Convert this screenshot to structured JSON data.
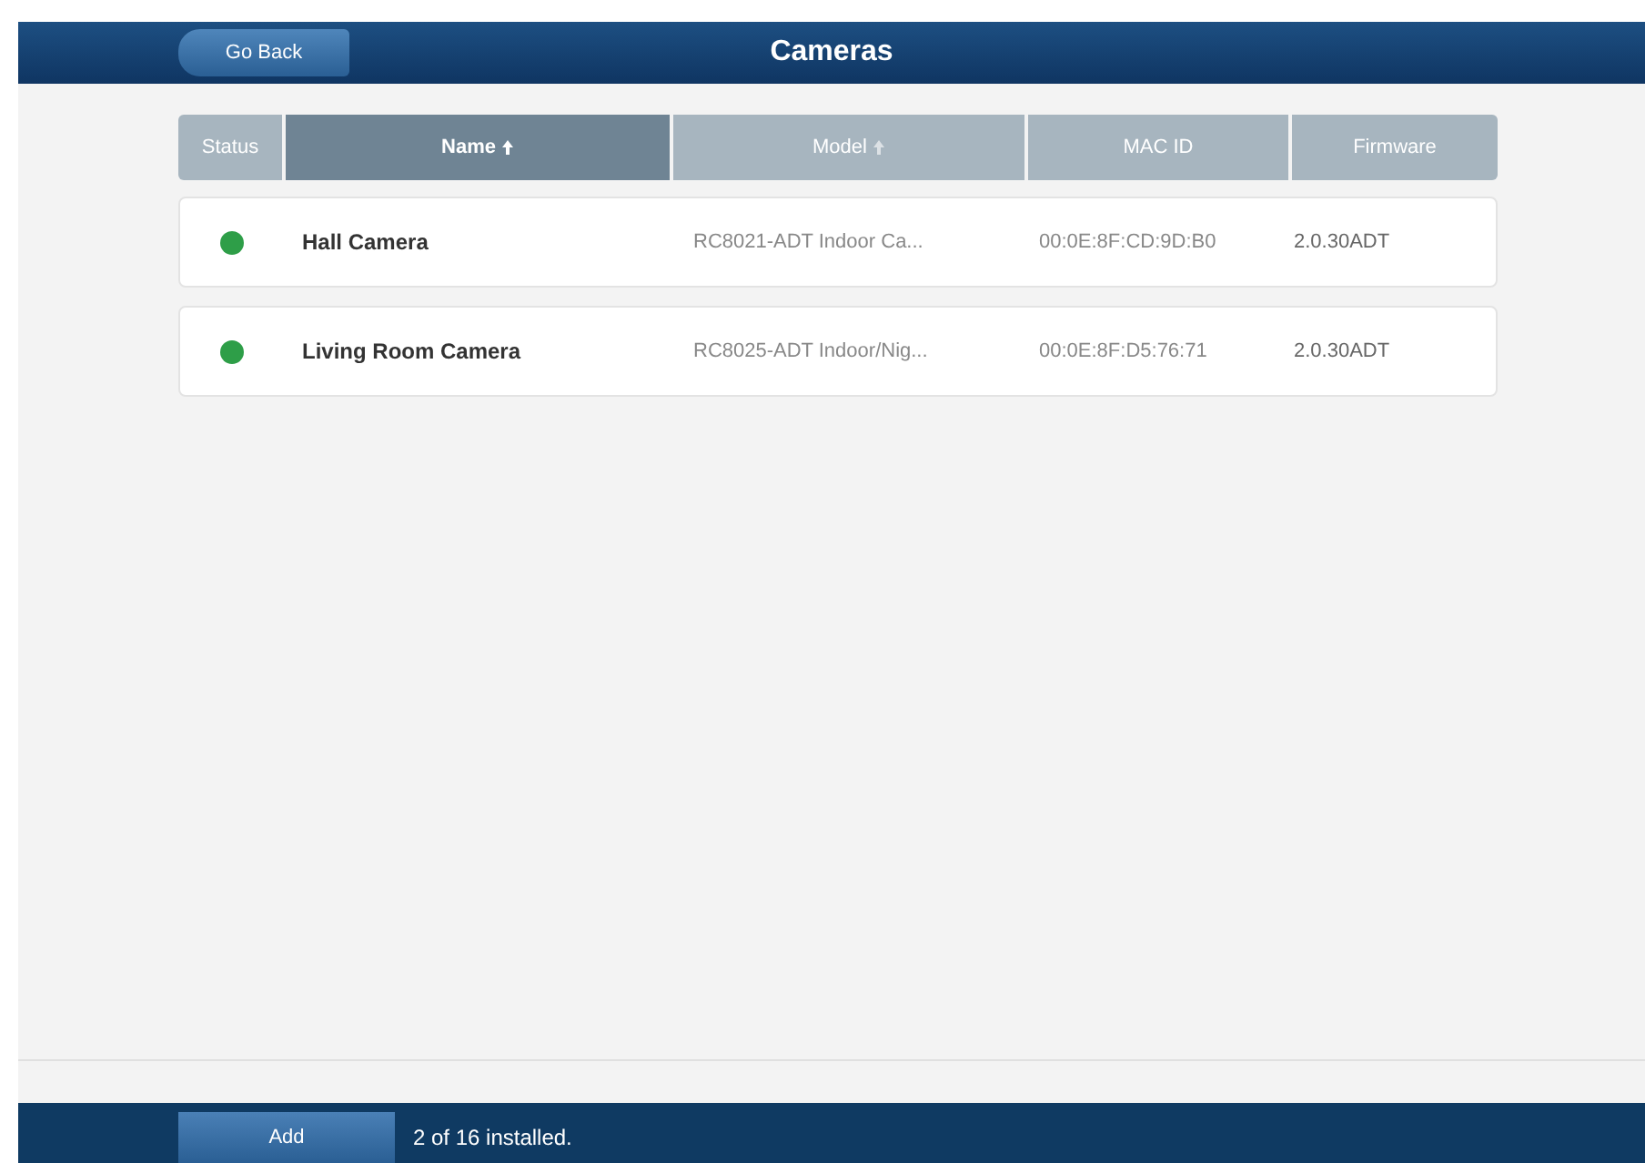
{
  "header": {
    "back_button": "Go Back",
    "title": "Cameras"
  },
  "table": {
    "columns": [
      {
        "label": "Status",
        "selected": false,
        "sort_arrow": false
      },
      {
        "label": "Name",
        "selected": true,
        "sort_arrow": true
      },
      {
        "label": "Model",
        "selected": false,
        "sort_arrow": true
      },
      {
        "label": "MAC ID",
        "selected": false,
        "sort_arrow": false
      },
      {
        "label": "Firmware",
        "selected": false,
        "sort_arrow": false
      }
    ],
    "rows": [
      {
        "color": "#2e9e48",
        "name": "Hall Camera",
        "model": "RC8021-ADT Indoor Ca...",
        "mac_id": "00:0E:8F:CD:9D:B0",
        "firmware": "2.0.30ADT"
      },
      {
        "color": "#2e9e48",
        "name": "Living Room Camera",
        "model": "RC8025-ADT Indoor/Nig...",
        "mac_id": "00:0E:8F:D5:76:71",
        "firmware": "2.0.30ADT"
      }
    ]
  },
  "footer": {
    "add_button": "Add",
    "status": "2 of 16 installed."
  }
}
